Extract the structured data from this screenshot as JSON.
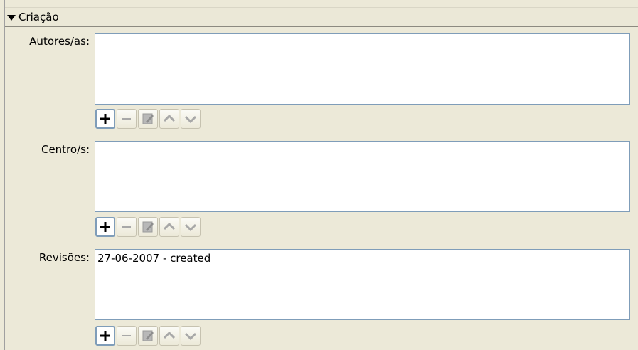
{
  "section": {
    "title": "Criação"
  },
  "fields": [
    {
      "label": "Autores/as:",
      "items": []
    },
    {
      "label": "Centro/s:",
      "items": []
    },
    {
      "label": "Revisões:",
      "items": [
        "27-06-2007 - created"
      ]
    }
  ],
  "toolbar_icons": [
    "plus-icon",
    "minus-icon",
    "edit-icon",
    "chevron-up-icon",
    "chevron-down-icon"
  ],
  "colors": {
    "background": "#ece9d8",
    "list_border": "#7f9db9",
    "disabled_icon": "#a8a8a8"
  }
}
